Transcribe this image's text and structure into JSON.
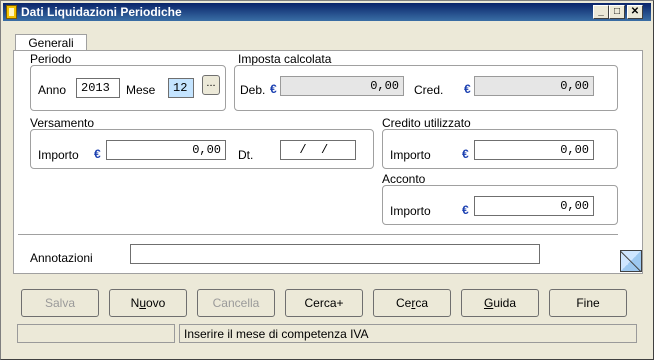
{
  "window": {
    "title": "Dati Liquidazioni Periodiche",
    "min_label": "_",
    "max_label": "□",
    "close_label": "✕"
  },
  "tab": {
    "label": "Generali"
  },
  "periodo": {
    "title": "Periodo",
    "anno_label": "Anno",
    "anno_value": "2013",
    "mese_label": "Mese",
    "mese_value": "12",
    "dots_label": "..."
  },
  "imposta": {
    "title": "Imposta calcolata",
    "deb_label": "Deb.",
    "deb_value": "0,00",
    "cred_label": "Cred.",
    "cred_value": "0,00"
  },
  "versamento": {
    "title": "Versamento",
    "importo_label": "Importo",
    "importo_value": "0,00",
    "dt_label": "Dt.",
    "dt_value": "  /  /"
  },
  "credito": {
    "title": "Credito utilizzato",
    "importo_label": "Importo",
    "importo_value": "0,00"
  },
  "acconto": {
    "title": "Acconto",
    "importo_label": "Importo",
    "importo_value": "0,00"
  },
  "annotazioni": {
    "label": "Annotazioni",
    "value": ""
  },
  "currency_symbol": "€",
  "buttons": {
    "salva": "Salva",
    "nuovo_pre": "N",
    "nuovo_ul": "u",
    "nuovo_post": "ovo",
    "cancella": "Cancella",
    "cercaplus": "Cerca+",
    "cerca_pre": "Ce",
    "cerca_ul": "r",
    "cerca_post": "ca",
    "guida_ul": "G",
    "guida_post": "uida",
    "fine": "Fine"
  },
  "status": {
    "left": "",
    "message": "Inserire il mese di competenza IVA"
  }
}
